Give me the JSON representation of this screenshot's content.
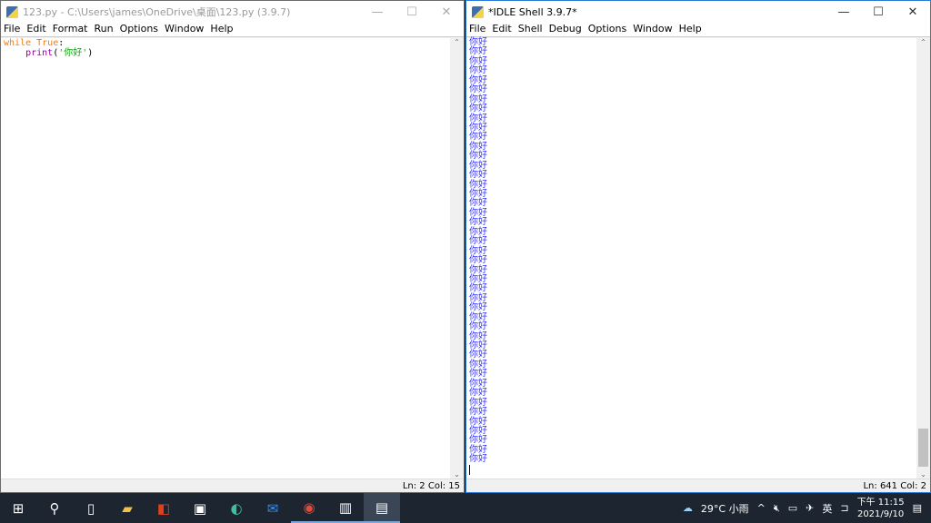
{
  "editor": {
    "title": "123.py - C:\\Users\\james\\OneDrive\\桌面\\123.py (3.9.7)",
    "menu": [
      "File",
      "Edit",
      "Format",
      "Run",
      "Options",
      "Window",
      "Help"
    ],
    "code": {
      "kw1": "while",
      "sp": " ",
      "kw2": "True",
      "colon": ":",
      "indent": "    ",
      "fn": "print",
      "open": "(",
      "str": "'你好'",
      "close": ")"
    },
    "status": "Ln: 2   Col: 15"
  },
  "shell": {
    "title": "*IDLE Shell 3.9.7*",
    "menu": [
      "File",
      "Edit",
      "Shell",
      "Debug",
      "Options",
      "Window",
      "Help"
    ],
    "lines": [
      "你好",
      "你好",
      "你好",
      "你好",
      "你好",
      "你好",
      "你好",
      "你好",
      "你好",
      "你好",
      "你好",
      "你好",
      "你好",
      "你好",
      "你好",
      "你好",
      "你好",
      "你好",
      "你好",
      "你好",
      "你好",
      "你好",
      "你好",
      "你好",
      "你好",
      "你好",
      "你好",
      "你好",
      "你好",
      "你好",
      "你好",
      "你好",
      "你好",
      "你好",
      "你好",
      "你好",
      "你好",
      "你好",
      "你好",
      "你好",
      "你好",
      "你好",
      "你好",
      "你好",
      "你好"
    ],
    "status": "Ln: 641   Col: 2"
  },
  "taskbar": {
    "apps": [
      "windows-start",
      "search",
      "task-view",
      "file-explorer",
      "office",
      "microsoft-store",
      "edge",
      "mail",
      "chrome",
      "app",
      "python-idle"
    ],
    "weather": "29°C 小雨",
    "ime": "英",
    "time": "下午 11:15",
    "date": "2021/9/10"
  }
}
